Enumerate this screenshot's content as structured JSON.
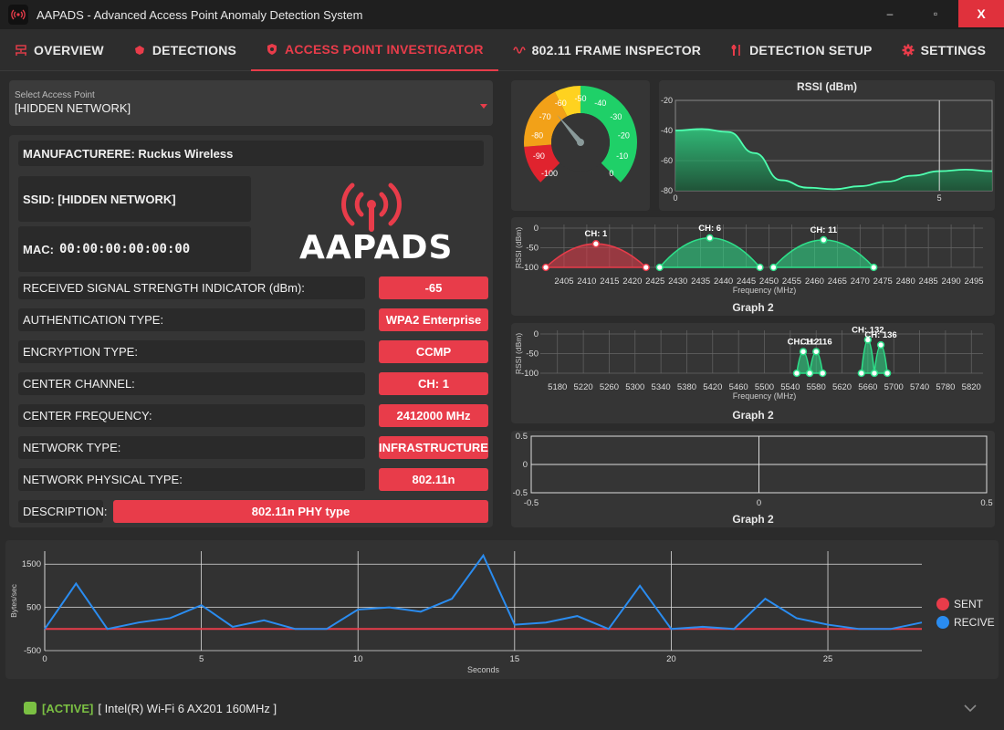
{
  "window": {
    "title": "AAPADS - Advanced Access Point Anomaly Detection System",
    "minimize": "–",
    "maximize": "▫",
    "close": "X"
  },
  "tabs": [
    {
      "label": "OVERVIEW",
      "icon": "network-icon"
    },
    {
      "label": "DETECTIONS",
      "icon": "bug-icon"
    },
    {
      "label": "ACCESS POINT INVESTIGATOR",
      "icon": "shield-icon",
      "active": true
    },
    {
      "label": "802.11 FRAME INSPECTOR",
      "icon": "wave-icon"
    },
    {
      "label": "DETECTION SETUP",
      "icon": "tools-icon"
    },
    {
      "label": "SETTINGS",
      "icon": "gear-icon"
    }
  ],
  "access_point_select": {
    "label": "Select Access Point",
    "value": "[HIDDEN NETWORK]"
  },
  "ap_info": {
    "manufacturer": "MANUFACTURERE: Ruckus Wireless",
    "ssid": "SSID: [HIDDEN NETWORK]",
    "mac_label": "MAC:",
    "mac_value": "00:00:00:00:00:00",
    "logo_text": "AAPADS",
    "rows": [
      {
        "label": "RECEIVED SIGNAL STRENGTH INDICATOR (dBm):",
        "value": "-65"
      },
      {
        "label": "AUTHENTICATION TYPE:",
        "value": "WPA2 Enterprise"
      },
      {
        "label": "ENCRYPTION TYPE:",
        "value": "CCMP"
      },
      {
        "label": "CENTER CHANNEL:",
        "value": "CH: 1"
      },
      {
        "label": "CENTER FREQUENCY:",
        "value": "2412000 MHz"
      },
      {
        "label": "NETWORK TYPE:",
        "value": "INFRASTRUCTURE"
      },
      {
        "label": "NETWORK PHYSICAL TYPE:",
        "value": "802.11n"
      }
    ],
    "description_label": "DESCRIPTION:",
    "description_value": "802.11n PHY type"
  },
  "gauge": {
    "value": -65,
    "min": -100,
    "max": 0,
    "ticks": [
      "-100",
      "-90",
      "-80",
      "-70",
      "-60",
      "-50",
      "-40",
      "-30",
      "-20",
      "-10",
      "0"
    ],
    "colors": {
      "red": "#e0232e",
      "orange": "#f2a118",
      "yellow": "#ffd21f",
      "green": "#1fd068"
    }
  },
  "rssi_chart": {
    "title": "RSSI (dBm)",
    "y_ticks": [
      "-20",
      "-40",
      "-60",
      "-80"
    ],
    "x_ticks": [
      "0",
      "5"
    ],
    "ylim": [
      -80,
      -20
    ],
    "xlim": [
      0,
      6
    ],
    "x": [
      0,
      0.5,
      1,
      1.5,
      2,
      2.5,
      3,
      3.5,
      4,
      4.5,
      5,
      5.5,
      6
    ],
    "y": [
      -40,
      -39,
      -41,
      -55,
      -73,
      -78,
      -79,
      -77,
      -74,
      -70,
      -67,
      -66,
      -67
    ],
    "cursor_x": 5
  },
  "channel_chart_24": {
    "title": "Graph 2",
    "ylabel": "RSSI (dBm)",
    "xlabel": "Frequency (MHz)",
    "y_ticks": [
      "0",
      "-50",
      "-100"
    ],
    "x_ticks": [
      "2405",
      "2410",
      "2415",
      "2420",
      "2425",
      "2430",
      "2435",
      "2440",
      "2445",
      "2450",
      "2455",
      "2460",
      "2465",
      "2470",
      "2475",
      "2480",
      "2485",
      "2490",
      "2495"
    ],
    "xlim": [
      2401,
      2497
    ],
    "ylim": [
      -100,
      0
    ],
    "networks": [
      {
        "label": "CH: 1",
        "center": 2412,
        "width": 22,
        "peak": -40,
        "color": "#e83c4a"
      },
      {
        "label": "CH: 6",
        "center": 2437,
        "width": 22,
        "peak": -25,
        "color": "#2ee08a"
      },
      {
        "label": "CH: 11",
        "center": 2462,
        "width": 22,
        "peak": -30,
        "color": "#2ee08a"
      }
    ]
  },
  "channel_chart_5": {
    "title": "Graph 2",
    "ylabel": "RSSI (dBm)",
    "xlabel": "Frequency (MHz)",
    "y_ticks": [
      "0",
      "-50",
      "-100"
    ],
    "x_ticks": [
      "5180",
      "5220",
      "5260",
      "5300",
      "5340",
      "5380",
      "5420",
      "5460",
      "5500",
      "5540",
      "5580",
      "5620",
      "5660",
      "5700",
      "5740",
      "5780",
      "5820"
    ],
    "xlim": [
      5162,
      5838
    ],
    "ylim": [
      -100,
      0
    ],
    "networks": [
      {
        "label": "CH: 112",
        "center": 5560,
        "width": 20,
        "peak": -45,
        "color": "#2ee08a"
      },
      {
        "label": "CH: 116",
        "center": 5580,
        "width": 20,
        "peak": -45,
        "color": "#2ee08a"
      },
      {
        "label": "CH: 132",
        "center": 5660,
        "width": 20,
        "peak": -15,
        "color": "#2ee08a"
      },
      {
        "label": "CH: 136",
        "center": 5680,
        "width": 20,
        "peak": -28,
        "color": "#2ee08a"
      }
    ]
  },
  "empty_chart": {
    "title": "Graph 2",
    "y_ticks": [
      "0.5",
      "0",
      "-0.5"
    ],
    "x_ticks": [
      "-0.5",
      "0",
      "0.5"
    ]
  },
  "traffic_chart": {
    "ylabel": "Bytes/sec",
    "xlabel": "Seconds",
    "y_ticks": [
      "1500",
      "500",
      "-500"
    ],
    "x_ticks": [
      "0",
      "5",
      "10",
      "15",
      "20",
      "25"
    ],
    "xlim": [
      0,
      28
    ],
    "ylim": [
      -500,
      1800
    ],
    "series": [
      {
        "name": "SENT",
        "color": "#e83c4a",
        "values": [
          0,
          0,
          0,
          0,
          0,
          0,
          0,
          0,
          0,
          0,
          0,
          0,
          0,
          0,
          0,
          0,
          0,
          0,
          0,
          0,
          0,
          0,
          0,
          0,
          0,
          0,
          0,
          0,
          0
        ]
      },
      {
        "name": "RECIVE",
        "color": "#2a8cf0",
        "values": [
          0,
          1050,
          0,
          150,
          250,
          550,
          50,
          200,
          0,
          0,
          450,
          500,
          400,
          700,
          1700,
          100,
          150,
          300,
          0,
          1000,
          0,
          50,
          0,
          700,
          250,
          100,
          0,
          0,
          150
        ]
      }
    ]
  },
  "status": {
    "state": "[ACTIVE]",
    "adapter": "[ Intel(R) Wi-Fi 6 AX201 160MHz ]"
  }
}
